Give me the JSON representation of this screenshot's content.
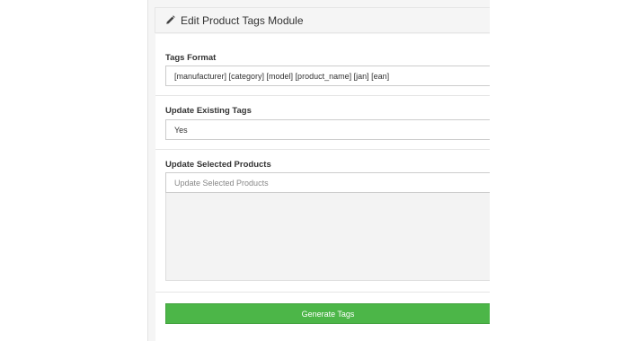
{
  "panel": {
    "title": "Edit Product Tags Module",
    "title_icon": "pencil-icon"
  },
  "form": {
    "tags_format": {
      "label": "Tags Format",
      "value": "[manufacturer] [category] [model] [product_name] [jan] [ean]"
    },
    "update_existing": {
      "label": "Update Existing Tags",
      "value": "Yes"
    },
    "update_selected": {
      "label": "Update Selected Products",
      "placeholder": "Update Selected Products"
    },
    "generate_button": {
      "label": "Generate Tags"
    }
  },
  "colors": {
    "accent_green": "#4cb648",
    "panel_background": "#f5f5f5",
    "listbox_background": "#f3f3f3"
  }
}
